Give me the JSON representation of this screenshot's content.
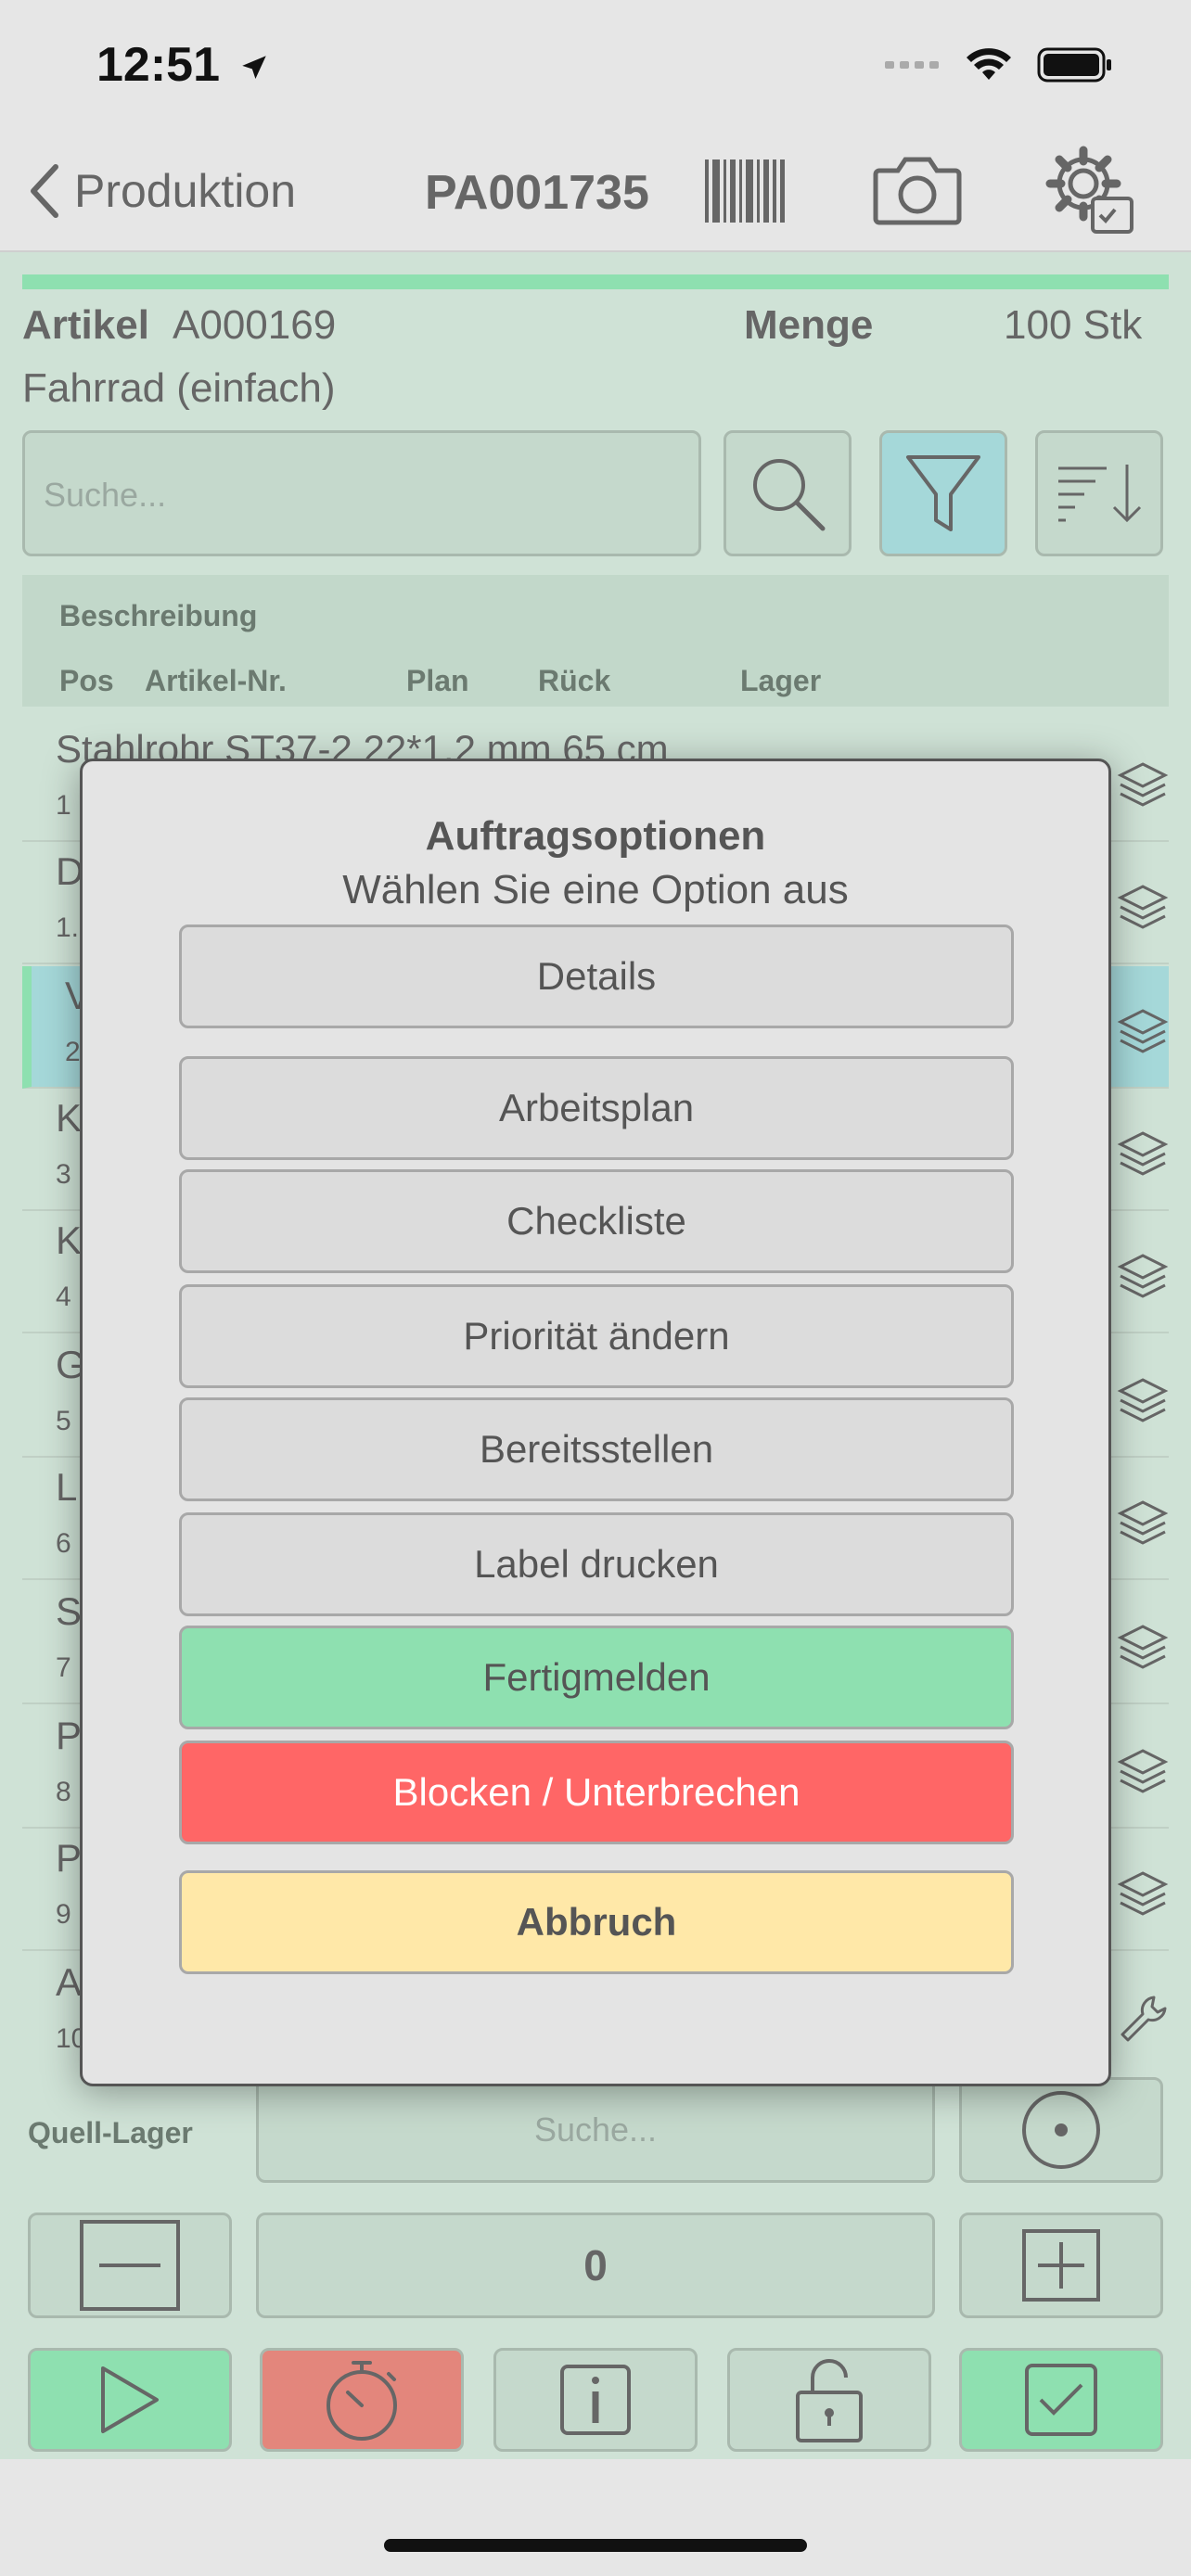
{
  "status_bar": {
    "time": "12:51"
  },
  "nav": {
    "back_label": "Produktion",
    "title": "PA001735"
  },
  "article": {
    "label": "Artikel",
    "number": "A000169",
    "menge_label": "Menge",
    "menge_value": "100 Stk",
    "name": "Fahrrad (einfach)"
  },
  "search": {
    "placeholder": "Suche..."
  },
  "list_header": {
    "beschreibung": "Beschreibung",
    "pos": "Pos",
    "artikel_nr": "Artikel-Nr.",
    "plan": "Plan",
    "rueck": "Rück",
    "lager": "Lager"
  },
  "rows": [
    {
      "title": "Stahlrohr ST37-2 22*1,2 mm 65 cm",
      "num": "1"
    },
    {
      "title": "D",
      "num": "1."
    },
    {
      "title": "V",
      "num": "2"
    },
    {
      "title": "K",
      "num": "3"
    },
    {
      "title": "K",
      "num": "4"
    },
    {
      "title": "G",
      "num": "5"
    },
    {
      "title": "L",
      "num": "6"
    },
    {
      "title": "S",
      "num": "7"
    },
    {
      "title": "P",
      "num": "8"
    },
    {
      "title": "P",
      "num": "9"
    },
    {
      "title": "A",
      "num": "10"
    }
  ],
  "bottom": {
    "quell_lager_label": "Quell-Lager",
    "quell_lager_placeholder": "Suche...",
    "quantity": "0"
  },
  "modal": {
    "title": "Auftragsoptionen",
    "subtitle": "Wählen Sie eine Option aus",
    "options": {
      "details": "Details",
      "arbeitsplan": "Arbeitsplan",
      "checkliste": "Checkliste",
      "prioritaet": "Priorität ändern",
      "bereitsstellen": "Bereitsstellen",
      "label": "Label drucken",
      "fertigmelden": "Fertigmelden",
      "blocken": "Blocken / Unterbrechen",
      "abbruch": "Abbruch"
    }
  },
  "colors": {
    "green_bg": "#cfe2d6",
    "accent_green": "#8ee0b0",
    "danger_red": "#ff6666",
    "cancel_yellow": "#ffe8a8",
    "filter_teal": "#a5d8d9",
    "timer_red": "#e3867c"
  }
}
